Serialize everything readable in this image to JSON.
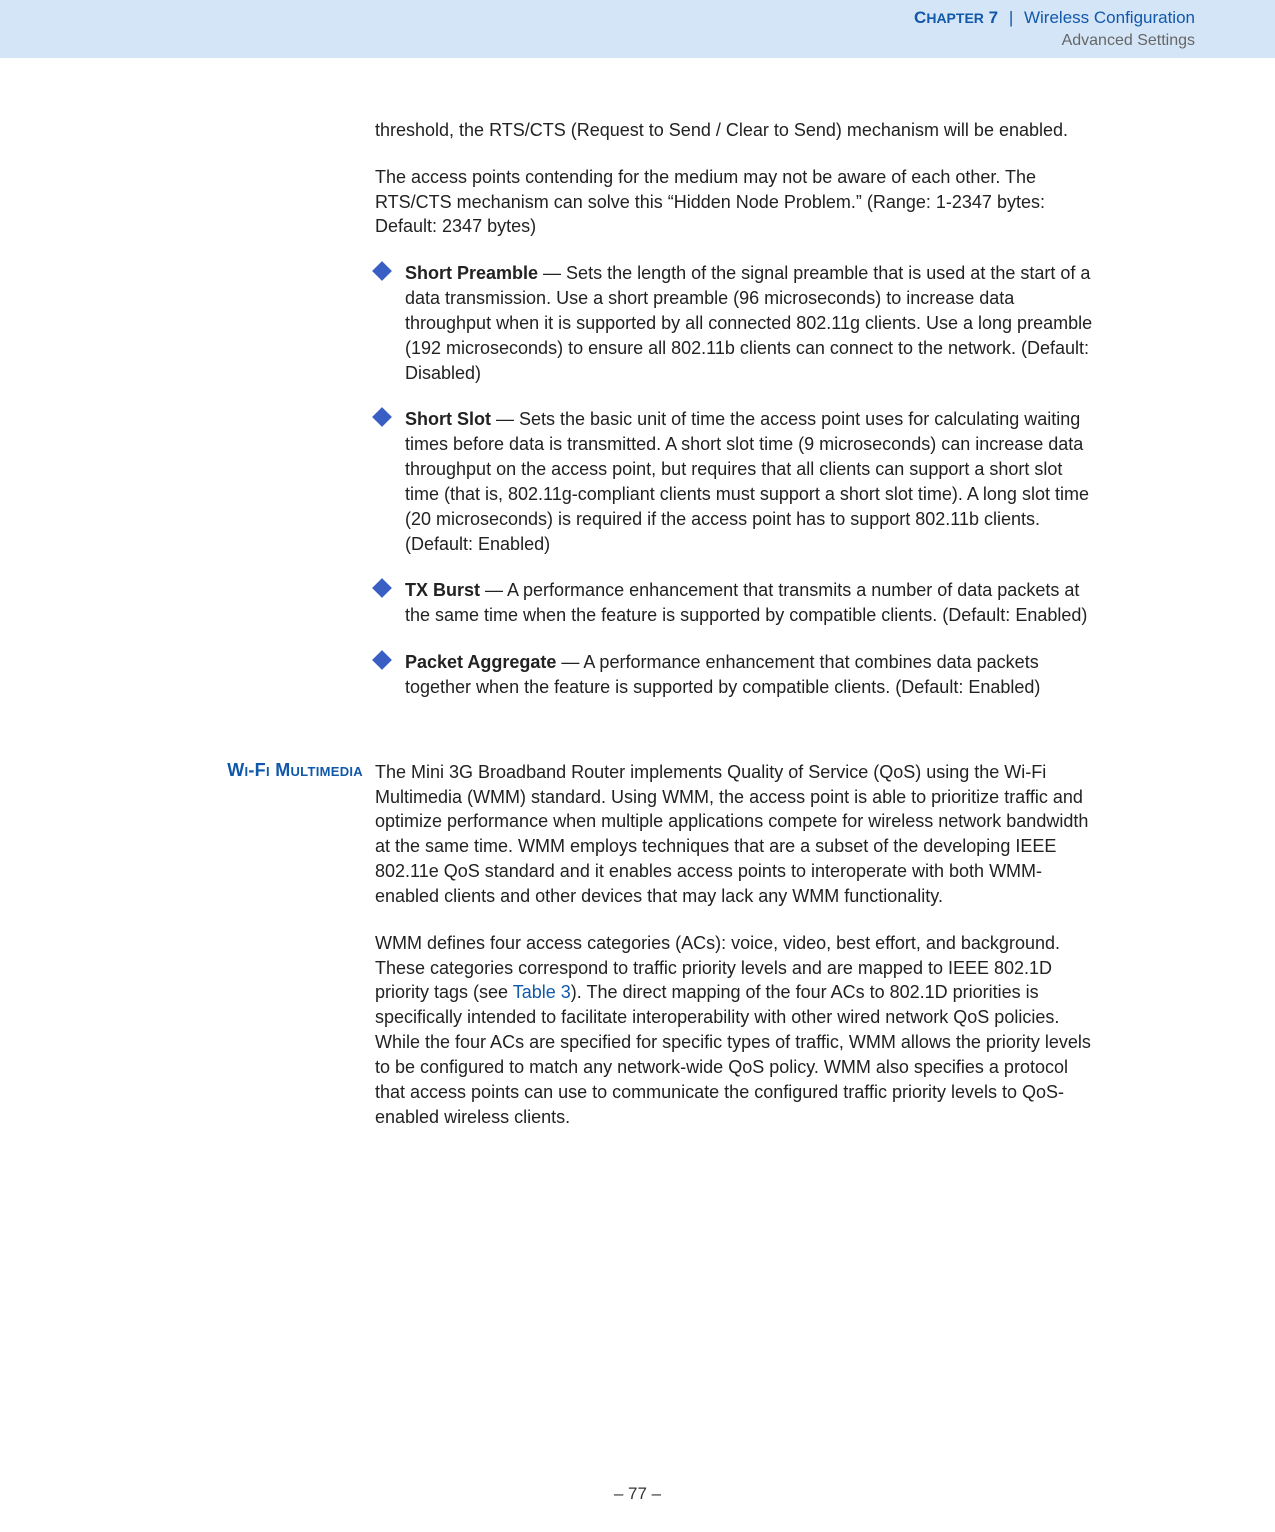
{
  "header": {
    "chapter_prefix": "C",
    "chapter_rest": "HAPTER",
    "chapter_num": "7",
    "separator": "|",
    "title": "Wireless Configuration",
    "subtitle": "Advanced Settings"
  },
  "intro": {
    "p1": "threshold, the RTS/CTS (Request to Send / Clear to Send) mechanism will be enabled.",
    "p2": "The access points contending for the medium may not be aware of each other. The RTS/CTS mechanism can solve this “Hidden Node Problem.” (Range: 1-2347 bytes: Default: 2347 bytes)"
  },
  "bullets": [
    {
      "bold": "Short Preamble",
      "rest": " — Sets the length of the signal preamble that is used at the start of a data transmission. Use a short preamble (96 microseconds) to increase data throughput when it is supported by all connected 802.11g clients. Use a long preamble (192 microseconds) to ensure all 802.11b clients can connect to the network. (Default: Disabled)"
    },
    {
      "bold": "Short Slot",
      "rest": " — Sets the basic unit of time the access point uses for calculating waiting times before data is transmitted. A short slot time (9 microseconds) can increase data throughput on the access point, but requires that all clients can support a short slot time (that is, 802.11g-compliant clients must support a short slot time). A long slot time (20 microseconds) is required if the access point has to support 802.11b clients. (Default: Enabled)"
    },
    {
      "bold": "TX Burst",
      "rest": " — A performance enhancement that transmits a number of data packets at the same time when the feature is supported by compatible clients. (Default: Enabled)"
    },
    {
      "bold": "Packet Aggregate",
      "rest": " — A performance enhancement that combines data packets together when the feature is supported by compatible clients. (Default: Enabled)"
    }
  ],
  "section": {
    "heading": "Wi-Fi Multimedia",
    "p1": "The Mini 3G Broadband Router implements Quality of Service (QoS) using the Wi-Fi Multimedia (WMM) standard. Using WMM, the access point is able to prioritize traffic and optimize performance when multiple applications compete for wireless network bandwidth at the same time. WMM employs techniques that are a subset of the developing IEEE 802.11e QoS standard and it enables access points to interoperate with both WMM-enabled clients and other devices that may lack any WMM functionality.",
    "p2_pre": "WMM defines four access categories (ACs): voice, video, best effort, and background. These categories correspond to traffic priority levels and are mapped to IEEE 802.1D priority tags (see ",
    "p2_link": "Table 3",
    "p2_post": "). The direct mapping of the four ACs to 802.1D priorities is specifically intended to facilitate interoperability with other wired network QoS policies. While the four ACs are specified for specific types of traffic, WMM allows the priority levels to be configured to match any network-wide QoS policy. WMM also specifies a protocol that access points can use to communicate the configured traffic priority levels to QoS-enabled wireless clients."
  },
  "footer": {
    "page": "–  77  –"
  }
}
